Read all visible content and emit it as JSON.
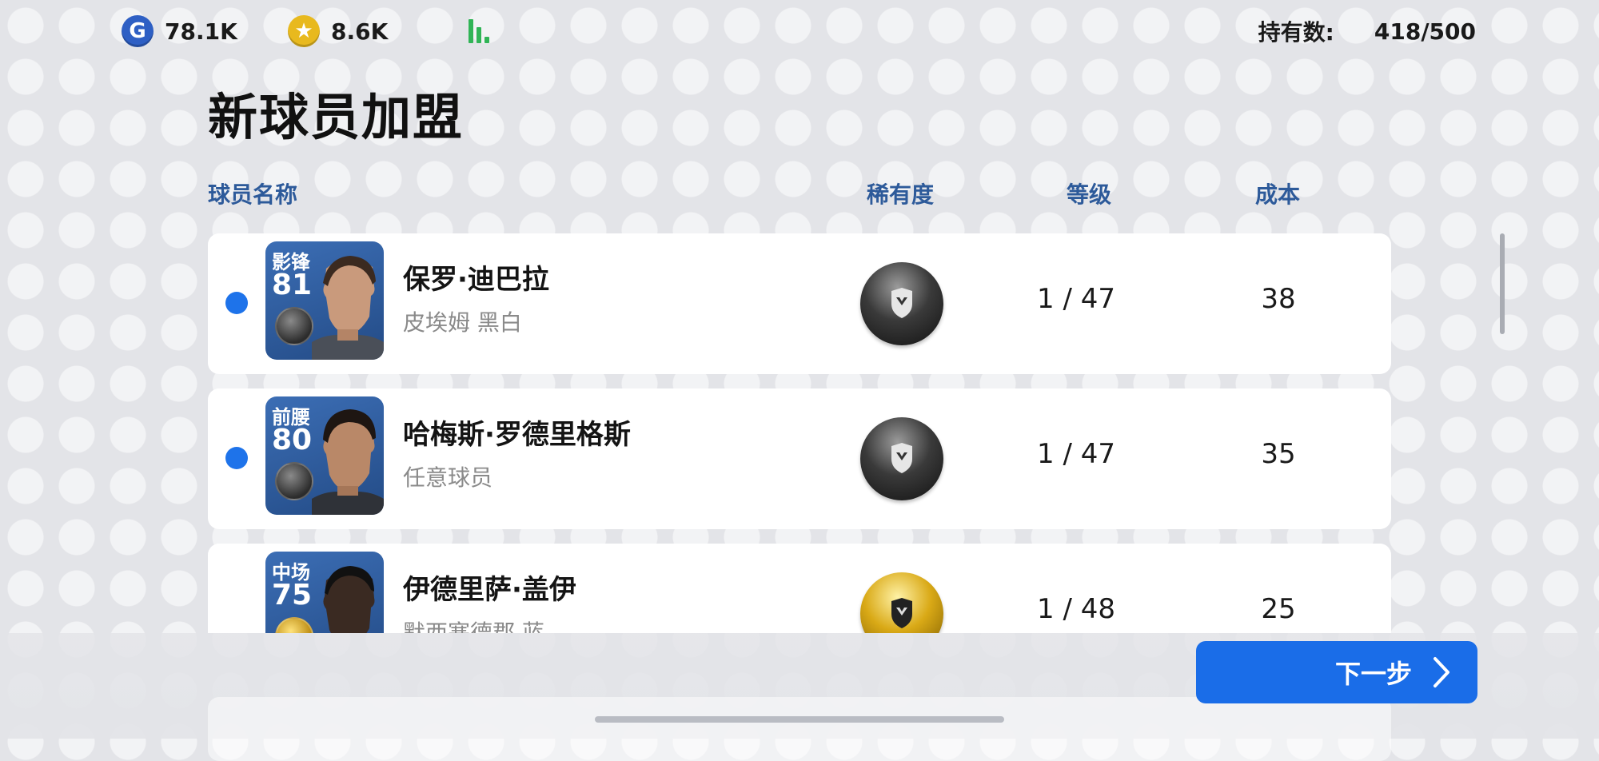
{
  "topbar": {
    "gp_icon": "G",
    "gp_amount": "78.1K",
    "coin_amount": "8.6K",
    "owned_label": "持有数:",
    "owned_value": "418/500"
  },
  "page_title": "新球员加盟",
  "columns": {
    "name": "球员名称",
    "rarity": "稀有度",
    "level": "等级",
    "cost": "成本"
  },
  "players": [
    {
      "position": "影锋",
      "rating": "81",
      "name": "保罗·迪巴拉",
      "team": "皮埃姆 黑白",
      "rarity": "black",
      "level": "1 / 47",
      "cost": "38",
      "selected": true
    },
    {
      "position": "前腰",
      "rating": "80",
      "name": "哈梅斯·罗德里格斯",
      "team": "任意球员",
      "rarity": "black",
      "level": "1 / 47",
      "cost": "35",
      "selected": true
    },
    {
      "position": "中场",
      "rating": "75",
      "name": "伊德里萨·盖伊",
      "team": "默西塞德郡 蓝",
      "rarity": "gold",
      "level": "1 / 48",
      "cost": "25",
      "selected": false
    }
  ],
  "next_button": "下一步",
  "colors": {
    "accent_blue": "#1a6de8",
    "header_blue": "#2d5a9a",
    "selected_dot": "#1e73ea"
  }
}
